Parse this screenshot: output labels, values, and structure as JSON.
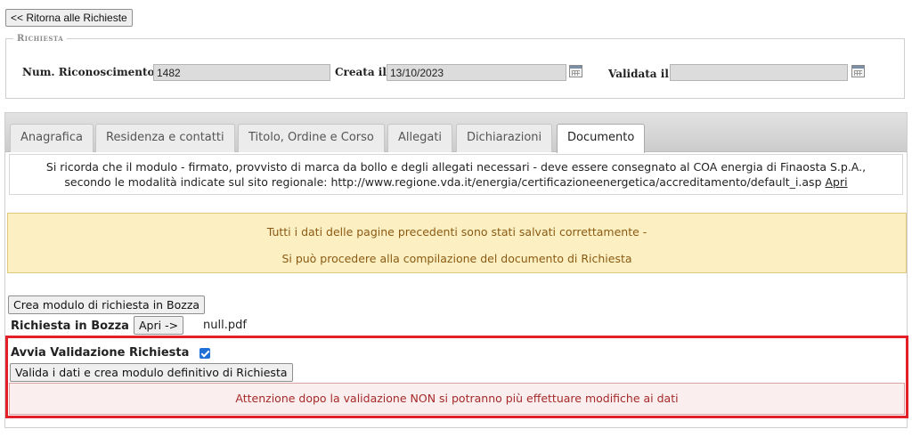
{
  "header": {
    "back_label": "<< Ritorna alle Richieste"
  },
  "request": {
    "legend": "Richiesta",
    "num_label": "Num. Riconoscimento",
    "num_value": "1482",
    "created_label": "Creata il",
    "created_value": "13/10/2023",
    "validated_label": "Validata il",
    "validated_value": ""
  },
  "tabs": [
    {
      "label": "Anagrafica"
    },
    {
      "label": "Residenza e contatti"
    },
    {
      "label": "Titolo, Ordine e Corso"
    },
    {
      "label": "Allegati"
    },
    {
      "label": "Dichiarazioni"
    },
    {
      "label": "Documento",
      "active": true
    }
  ],
  "info": {
    "line1": "Si ricorda che il modulo - firmato, provvisto di marca da bollo e degli allegati necessari - deve essere consegnato al COA energia di Finaosta S.p.A.,",
    "line2": "secondo le modalità indicate sul sito regionale: http://www.regione.vda.it/energia/certificazioneenergetica/accreditamento/default_i.asp",
    "link_label": "Apri"
  },
  "notice": {
    "line1": "Tutti i dati delle pagine precedenti sono stati salvati correttamente -",
    "line2": "Si può procedere alla compilazione del documento di Richiesta"
  },
  "draft": {
    "create_button": "Crea modulo di richiesta in Bozza",
    "label": "Richiesta in Bozza",
    "open_button": "Apri ->",
    "filename": "null.pdf"
  },
  "validation": {
    "label": "Avvia Validazione Richiesta",
    "checked": true,
    "button": "Valida i dati e crea modulo definitivo di Richiesta",
    "warning": "Attenzione dopo la validazione NON si potranno più effettuare modifiche ai dati"
  },
  "colors": {
    "highlight_border": "#e3202a",
    "notice_bg": "#fcf0c2",
    "warning_text": "#a52a2a"
  }
}
